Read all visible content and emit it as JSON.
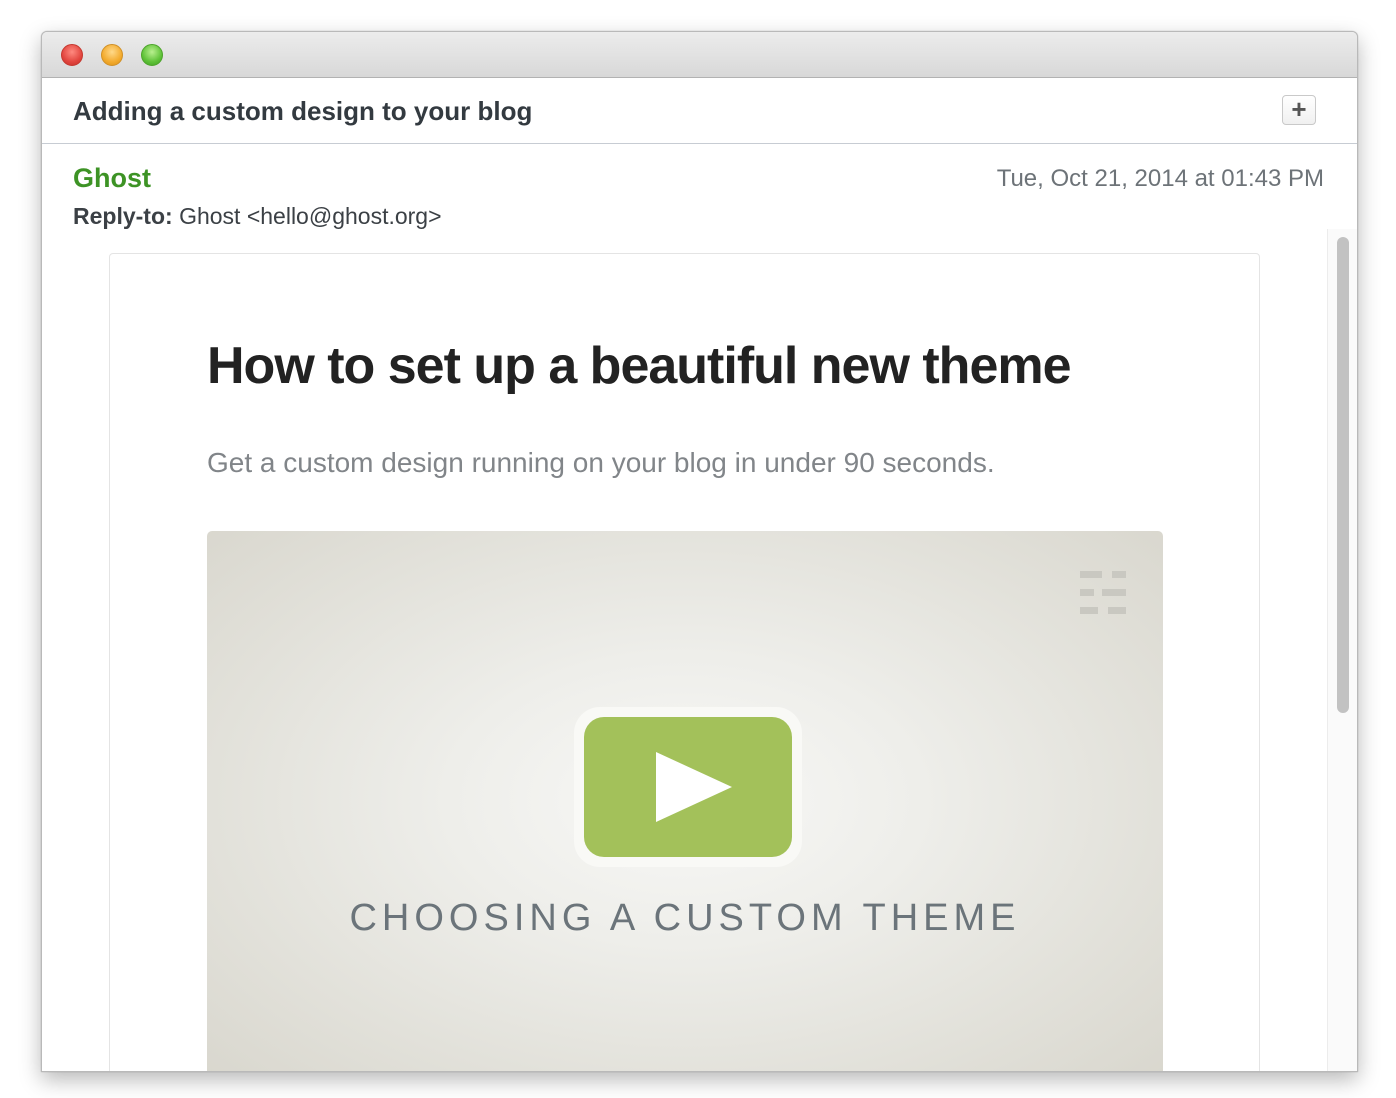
{
  "window": {
    "controls": [
      "close",
      "minimize",
      "maximize"
    ]
  },
  "message": {
    "subject": "Adding a custom design to your blog",
    "add_button_label": "+",
    "sender_name": "Ghost",
    "date": "Tue, Oct 21, 2014 at 01:43 PM",
    "reply_to_label": "Reply-to:",
    "reply_to_value": "Ghost <hello@ghost.org>"
  },
  "email_body": {
    "headline": "How to set up a beautiful new theme",
    "subheadline": "Get a custom design running on your blog in under 90 seconds.",
    "video": {
      "caption": "CHOOSING A CUSTOM THEME",
      "play_icon": "play-icon",
      "menu_icon": "menu-icon"
    }
  },
  "colors": {
    "sender": "#3d9325",
    "play_button": "#a3c15a",
    "headline": "#222222",
    "subheadline": "#818589"
  }
}
